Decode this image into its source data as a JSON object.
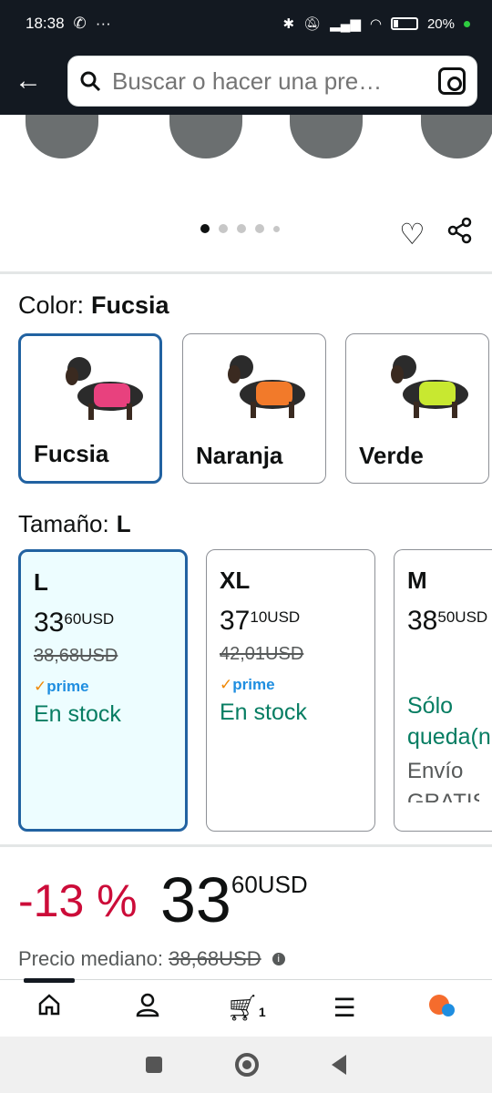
{
  "status_bar": {
    "time": "18:38",
    "battery": "20%"
  },
  "search": {
    "placeholder": "Buscar o hacer una pre…"
  },
  "gallery": {
    "dot_count": 5,
    "active_index": 0
  },
  "color": {
    "label": "Color:",
    "selected": "Fucsia",
    "options": [
      {
        "name": "Fucsia",
        "vest_color": "#e8417e"
      },
      {
        "name": "Naranja",
        "vest_color": "#f27a2a"
      },
      {
        "name": "Verde",
        "vest_color": "#c8e830"
      }
    ]
  },
  "size": {
    "label": "Tamaño:",
    "selected": "L",
    "options": [
      {
        "name": "L",
        "price_whole": "33",
        "price_fraction": "60",
        "currency": "USD",
        "old_price": "38,68USD",
        "prime": "prime",
        "stock": "En stock"
      },
      {
        "name": "XL",
        "price_whole": "37",
        "price_fraction": "10",
        "currency": "USD",
        "old_price": "42,01USD",
        "prime": "prime",
        "stock": "En stock"
      },
      {
        "name": "M",
        "price_whole": "38",
        "price_fraction": "50",
        "currency": "USD",
        "stock": "Sólo queda(n",
        "shipping": "Envío",
        "shipping_2": "GRATIS"
      }
    ]
  },
  "price": {
    "discount": "-13 %",
    "whole": "33",
    "fraction": "60",
    "currency": "USD",
    "median_label": "Precio mediano:",
    "median_value": "38,68USD"
  },
  "bottom_nav": {
    "cart_count": "1"
  },
  "colors": {
    "header_bg": "#131921",
    "selected_border": "#2162a1",
    "discount": "#cc0c39",
    "stock_green": "#067d62"
  }
}
